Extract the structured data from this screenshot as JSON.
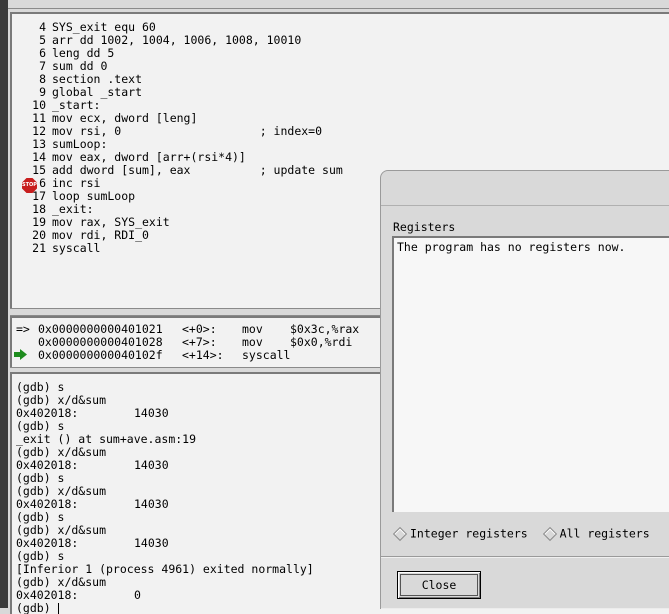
{
  "source": {
    "lines": [
      {
        "num": "4",
        "code": "SYS_exit equ 60"
      },
      {
        "num": "5",
        "code": "arr dd 1002, 1004, 1006, 1008, 10010"
      },
      {
        "num": "6",
        "code": "leng dd 5"
      },
      {
        "num": "7",
        "code": "sum dd 0"
      },
      {
        "num": "8",
        "code": "section .text"
      },
      {
        "num": "9",
        "code": "global _start"
      },
      {
        "num": "10",
        "code": "_start:"
      },
      {
        "num": "11",
        "code": "mov ecx, dword [leng]"
      },
      {
        "num": "12",
        "code": "mov rsi, 0                    ; index=0"
      },
      {
        "num": "13",
        "code": "sumLoop:"
      },
      {
        "num": "14",
        "code": "mov eax, dword [arr+(rsi*4)]"
      },
      {
        "num": "15",
        "code": "add dword [sum], eax          ; update sum"
      },
      {
        "num": "6",
        "code": "inc rsi"
      },
      {
        "num": "17",
        "code": "loop sumLoop"
      },
      {
        "num": "18",
        "code": "_exit:"
      },
      {
        "num": "19",
        "code": "mov rax, SYS_exit"
      },
      {
        "num": "20",
        "code": "mov rdi, RDI_0"
      },
      {
        "num": "21",
        "code": "syscall"
      }
    ],
    "breakpoint_label": "STOP"
  },
  "disassembly": [
    {
      "marker": "=>",
      "addr": "0x0000000000401021",
      "offset": "<+0>:",
      "op": "mov",
      "args": "$0x3c,%rax"
    },
    {
      "marker": "",
      "addr": "0x0000000000401028",
      "offset": "<+7>:",
      "op": "mov",
      "args": "$0x0,%rdi"
    },
    {
      "marker": "",
      "addr": "0x000000000040102f",
      "offset": "<+14>:",
      "op": "syscall",
      "args": ""
    }
  ],
  "console": {
    "lines": [
      {
        "text": "(gdb) s",
        "value": ""
      },
      {
        "text": "(gdb) x/d&sum",
        "value": ""
      },
      {
        "text": "0x402018:",
        "value": "14030"
      },
      {
        "text": "(gdb) s",
        "value": ""
      },
      {
        "text": "_exit () at sum+ave.asm:19",
        "value": ""
      },
      {
        "text": "(gdb) x/d&sum",
        "value": ""
      },
      {
        "text": "0x402018:",
        "value": "14030"
      },
      {
        "text": "(gdb) s",
        "value": ""
      },
      {
        "text": "(gdb) x/d&sum",
        "value": ""
      },
      {
        "text": "0x402018:",
        "value": "14030"
      },
      {
        "text": "(gdb) s",
        "value": ""
      },
      {
        "text": "(gdb) x/d&sum",
        "value": ""
      },
      {
        "text": "0x402018:",
        "value": "14030"
      },
      {
        "text": "(gdb) s",
        "value": ""
      },
      {
        "text": "[Inferior 1 (process 4961) exited normally]",
        "value": ""
      },
      {
        "text": "(gdb) x/d&sum",
        "value": ""
      },
      {
        "text": "0x402018:",
        "value": "0"
      },
      {
        "text": "(gdb) ",
        "value": ""
      }
    ]
  },
  "registers": {
    "heading": "Registers",
    "message": "The program has no registers now.",
    "radio_integer": "Integer registers",
    "radio_all": "All registers",
    "close_label": "Close"
  },
  "colors": {
    "breakpoint": "#c81e1e",
    "pc_arrow": "#1e8c1e",
    "pane_bg": "#f2f2f2",
    "chrome_bg": "#d9d9d9"
  }
}
